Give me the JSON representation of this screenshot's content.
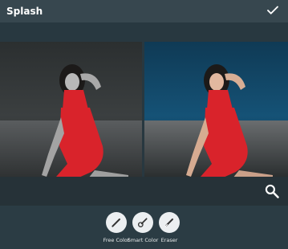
{
  "appbar": {
    "title": "Splash",
    "confirm_icon": "check-icon"
  },
  "tools": [
    {
      "label": "Free Color",
      "icon": "brush-icon"
    },
    {
      "label": "Smart Color",
      "icon": "smart-brush-icon"
    },
    {
      "label": "Eraser",
      "icon": "eraser-icon"
    }
  ],
  "colors": {
    "appbar": "#37474f",
    "background": "#283840",
    "accent_red": "#d9232b"
  }
}
